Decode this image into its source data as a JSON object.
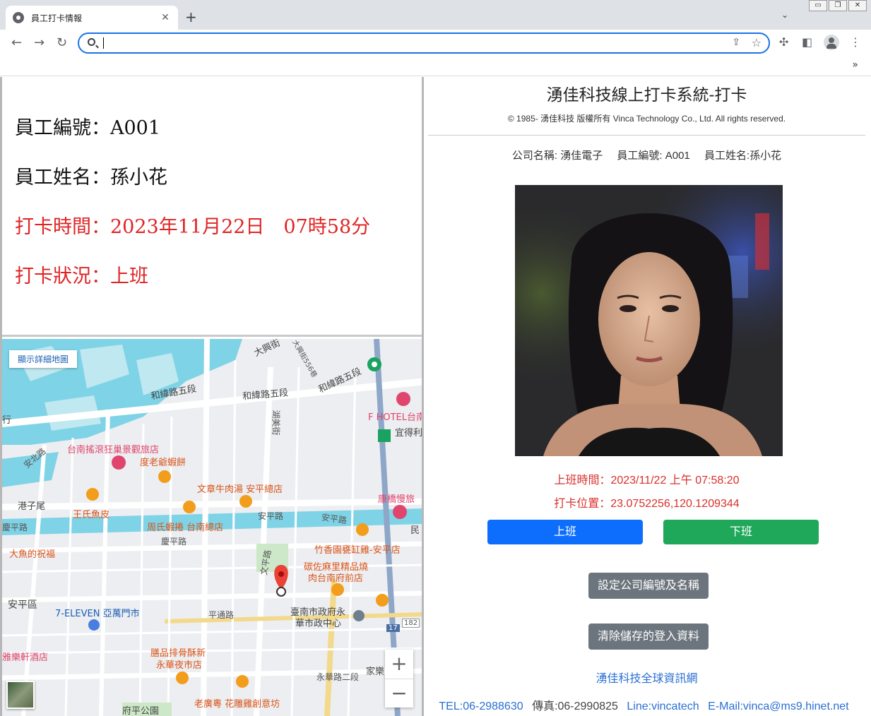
{
  "browser": {
    "tab_title": "員工打卡情報",
    "new_tab": "+",
    "tab_close": "✕",
    "address": "",
    "window_controls": [
      "▭",
      "❐",
      "✕"
    ]
  },
  "info": {
    "emp_no": "員工編號：A001",
    "emp_name": "員工姓名：孫小花",
    "punch_time": "打卡時間：2023年11月22日　07時58分",
    "punch_status": "打卡狀況：上班"
  },
  "map": {
    "detail_button": "顯示詳細地圖",
    "zoom_in": "+",
    "zoom_out": "−",
    "labels": {
      "l1": "大興街",
      "l2": "大興街556巷",
      "l3": "和緯路五段",
      "l4": "和緯路五段",
      "l5": "和緯路五段",
      "l6": "F HOTEL台南",
      "l7": "宜得利",
      "l8": "台南搖滾狂巢景觀旅店",
      "l9": "度老爺蝦餅",
      "l10": "文章牛肉湯 安平總店",
      "l11": "港子尾",
      "l12": "王氏魚皮",
      "l13": "周氏蝦捲 台南總店",
      "l14": "安平路",
      "l15": "安平路",
      "l16": "慶平路",
      "l17": "大魚的祝福",
      "l18": "竹香園甕缸雞-安平店",
      "l19": "碳佐麻里精品燒",
      "l20": "肉台南府前店",
      "l21": "安平區",
      "l22": "7-ELEVEN 亞萬門市",
      "l23": "平通路",
      "l24": "臺南市政府永",
      "l25": "華市政中心",
      "l26": "膳品排骨酥新",
      "l27": "永華夜市店",
      "l28": "雅樂軒酒店",
      "l29": "家樂",
      "l30": "老廣粵 花雕雞創意坊",
      "l31": "康橋慢旅",
      "l32": "安北路",
      "l33": "湖美街",
      "l34": "慶平路",
      "l35": "文平路",
      "l36": "永華路二段",
      "l37": "府平公園",
      "l38": "182",
      "l39": "17",
      "l40": "行",
      "l41": "民"
    }
  },
  "panel": {
    "title": "湧佳科技線上打卡系統-打卡",
    "copyright": "© 1985- 湧佳科技 版權所有 Vinca Technology Co., Ltd. All rights reserved.",
    "company": "公司名稱: 湧佳電子",
    "emp_no": "員工編號: A001",
    "emp_name": "員工姓名:孫小花",
    "clock_time": "上班時間：2023/11/22 上午 07:58:20",
    "clock_location": "打卡位置：23.0752256,120.1209344",
    "btn_in": "上班",
    "btn_out": "下班",
    "btn_settings": "設定公司編號及名稱",
    "btn_clear": "清除儲存的登入資料",
    "link": "湧佳科技全球資訊網",
    "tel": "TEL:06-2988630",
    "fax": "傳真:06-2990825",
    "line": "Line:vincatech",
    "email": "E-Mail:vinca@ms9.hinet.net"
  },
  "colors": {
    "red_text": "#e02424",
    "btn_blue": "#0d6efd",
    "btn_green": "#1fa85a",
    "btn_gray": "#6c757d",
    "link_blue": "#2a6fd1"
  }
}
